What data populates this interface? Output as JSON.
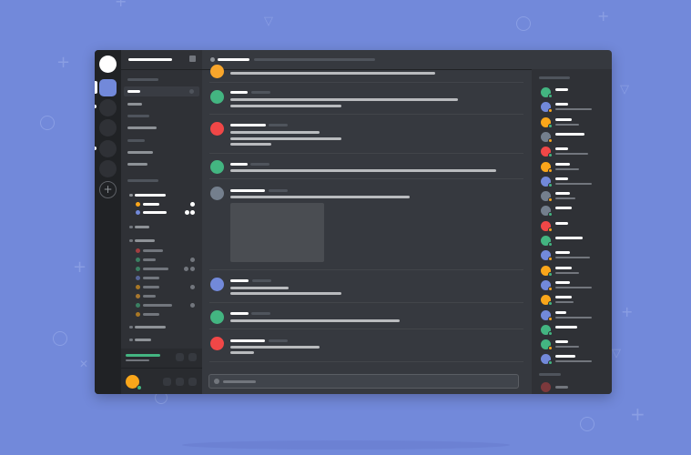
{
  "colors": {
    "background": "#7289da",
    "accent_blurple": "#7289da",
    "green": "#43b581",
    "red": "#f04747",
    "yellow": "#faa61a",
    "grey": "#747f8d",
    "orange": "#f9a62b"
  },
  "icons": {
    "home": "home-icon",
    "add_server": "plus-icon",
    "members": "members-icon"
  },
  "guilds": {
    "add_label": "+"
  }
}
